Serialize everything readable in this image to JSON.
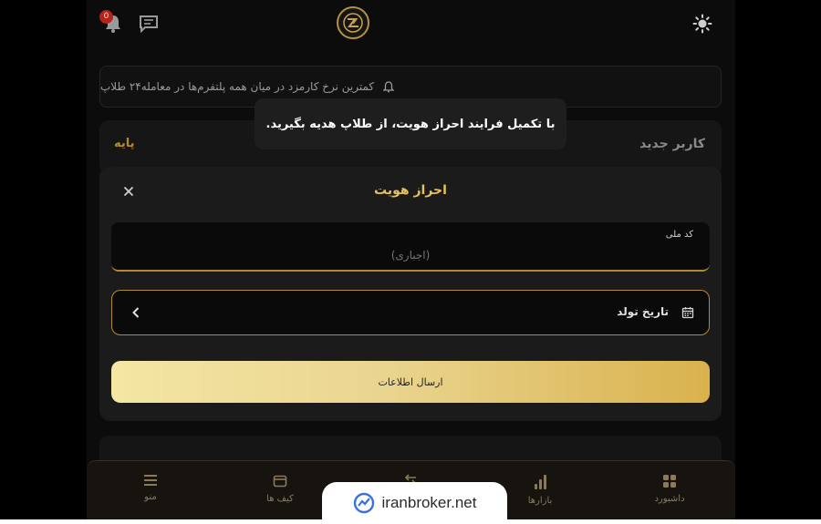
{
  "header": {
    "notification_count": "0",
    "icons": {
      "bell": "bell-icon",
      "chat": "chat-icon",
      "theme": "sun-icon",
      "logo": "brand-logo"
    }
  },
  "announcement": {
    "text": "کمترین نرخ کارمزد در میان همه پلتفرم‌ها در معامله۲۴ طلاپ",
    "icon": "bell-icon"
  },
  "user_level": {
    "title": "کاربر جدید",
    "badge": "پایه"
  },
  "tooltip": {
    "text": "با تکمیل فرایند احراز هویت، از طلاپ هدیه بگیرید."
  },
  "modal": {
    "title": "احراز هویت",
    "close_icon": "close-icon",
    "national_code": {
      "label": "کد ملی",
      "placeholder": "(اجباری)",
      "value": ""
    },
    "birth_date": {
      "label": "تاریخ تولد",
      "icon": "calendar-icon"
    },
    "submit_label": "ارسال اطلاعات"
  },
  "bottom_nav": {
    "items": [
      {
        "label": "منو",
        "icon": "menu-icon"
      },
      {
        "label": "کیف ها",
        "icon": "wallet-icon"
      },
      {
        "label": "",
        "icon": "swap-icon"
      },
      {
        "label": "بازارها",
        "icon": "bar-chart-icon"
      },
      {
        "label": "داشبورد",
        "icon": "dashboard-icon"
      }
    ]
  },
  "watermark": {
    "text": "iranbroker.net"
  },
  "colors": {
    "accent": "#b38a2e",
    "gold_light": "#f4e6a4",
    "gold_dark": "#d9b24d",
    "background": "#0c0c0c",
    "modal": "#1b1b1c"
  }
}
